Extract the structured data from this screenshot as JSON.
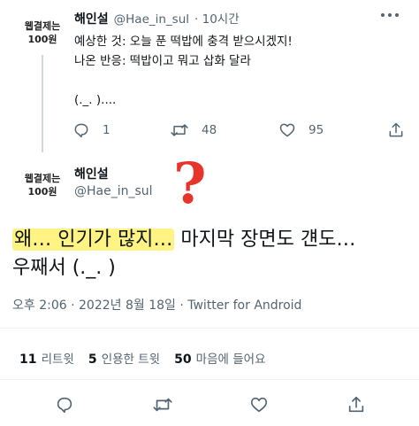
{
  "tweet1": {
    "avatar_text": "웹결제는\n100원",
    "display_name": "해인설",
    "handle": "@Hae_in_sul",
    "time": "· 10시간",
    "body": "예상한 것: 오늘 푼 떡밥에 충격 받으시겠지!\n나온 반응: 떡밥이고 뭐고 삽화 달라\n\n(._. )....",
    "replies": "1",
    "retweets": "48",
    "likes": "95"
  },
  "tweet2": {
    "avatar_text": "웹결제는\n100원",
    "display_name": "해인설",
    "handle": "@Hae_in_sul",
    "text_highlighted": "왜… 인기가 많지…",
    "text_rest": " 마지막 장면도 걘도…",
    "text_line2": "우째서 (._. )",
    "timestamp": "오후 2:06 · 2022년 8월 18일 · Twitter for Android",
    "stats": {
      "retweets_count": "11",
      "retweets_label": "리트윗",
      "quotes_count": "5",
      "quotes_label": "인용한 트윗",
      "likes_count": "50",
      "likes_label": "마음에 들어요"
    }
  },
  "annotation": {
    "symbol": "?",
    "color": "#e8352b"
  },
  "icons": [
    "more-icon",
    "reply-icon",
    "retweet-icon",
    "like-icon",
    "share-icon"
  ],
  "colors": {
    "muted": "#536471",
    "divider": "#eff3f4",
    "highlight": "#fff05a",
    "annotation": "#e8352b"
  }
}
